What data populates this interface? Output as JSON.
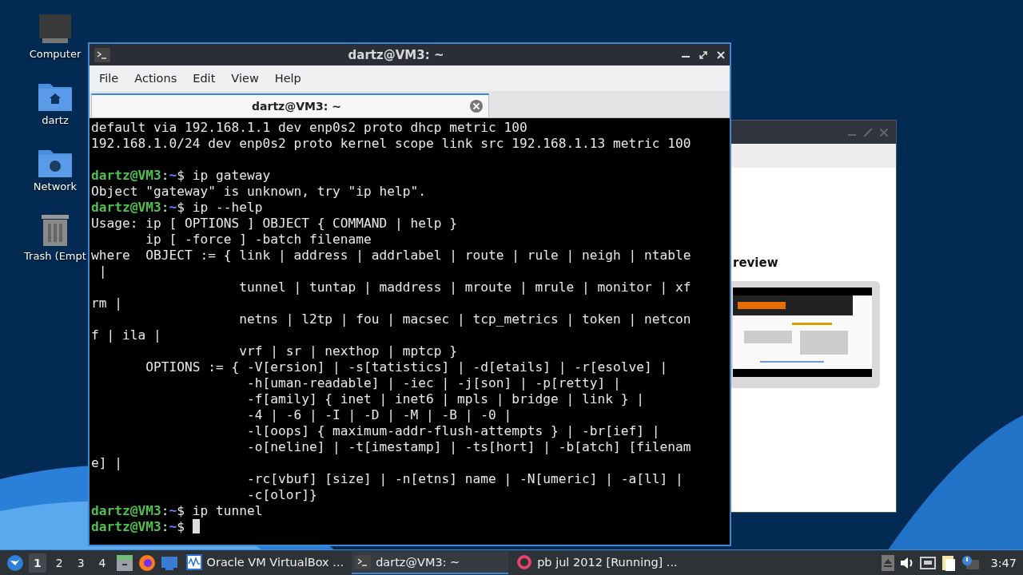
{
  "desktop_icons": [
    {
      "kind": "computer",
      "label": "Computer"
    },
    {
      "kind": "home",
      "label": "dartz"
    },
    {
      "kind": "network",
      "label": "Network"
    },
    {
      "kind": "trash",
      "label": "Trash (Empt"
    }
  ],
  "back_window": {
    "heading": "review"
  },
  "terminal": {
    "title": "dartz@VM3: ~",
    "menu": [
      "File",
      "Actions",
      "Edit",
      "View",
      "Help"
    ],
    "tabs": [
      {
        "label": "dartz@VM3: ~",
        "selected": true
      }
    ],
    "lines": [
      {
        "kind": "output",
        "text": "default via 192.168.1.1 dev enp0s2 proto dhcp metric 100"
      },
      {
        "kind": "output",
        "text": "192.168.1.0/24 dev enp0s2 proto kernel scope link src 192.168.1.13 metric 100"
      },
      {
        "kind": "blank"
      },
      {
        "kind": "prompt",
        "user": "dartz@VM3",
        "sep": ":",
        "path": "~",
        "sign": "$",
        "command": "ip gateway"
      },
      {
        "kind": "output",
        "text": "Object \"gateway\" is unknown, try \"ip help\"."
      },
      {
        "kind": "prompt",
        "user": "dartz@VM3",
        "sep": ":",
        "path": "~",
        "sign": "$",
        "command": "ip --help"
      },
      {
        "kind": "output",
        "text": "Usage: ip [ OPTIONS ] OBJECT { COMMAND | help }"
      },
      {
        "kind": "output",
        "text": "       ip [ -force ] -batch filename"
      },
      {
        "kind": "output",
        "text": "where  OBJECT := { link | address | addrlabel | route | rule | neigh | ntable"
      },
      {
        "kind": "output",
        "text": " |"
      },
      {
        "kind": "output",
        "text": "                   tunnel | tuntap | maddress | mroute | mrule | monitor | xf"
      },
      {
        "kind": "output",
        "text": "rm |"
      },
      {
        "kind": "output",
        "text": "                   netns | l2tp | fou | macsec | tcp_metrics | token | netcon"
      },
      {
        "kind": "output",
        "text": "f | ila |"
      },
      {
        "kind": "output",
        "text": "                   vrf | sr | nexthop | mptcp }"
      },
      {
        "kind": "output",
        "text": "       OPTIONS := { -V[ersion] | -s[tatistics] | -d[etails] | -r[esolve] |"
      },
      {
        "kind": "output",
        "text": "                    -h[uman-readable] | -iec | -j[son] | -p[retty] |"
      },
      {
        "kind": "output",
        "text": "                    -f[amily] { inet | inet6 | mpls | bridge | link } |"
      },
      {
        "kind": "output",
        "text": "                    -4 | -6 | -I | -D | -M | -B | -0 |"
      },
      {
        "kind": "output",
        "text": "                    -l[oops] { maximum-addr-flush-attempts } | -br[ief] |"
      },
      {
        "kind": "output",
        "text": "                    -o[neline] | -t[imestamp] | -ts[hort] | -b[atch] [filenam"
      },
      {
        "kind": "output",
        "text": "e] |"
      },
      {
        "kind": "output",
        "text": "                    -rc[vbuf] [size] | -n[etns] name | -N[umeric] | -a[ll] |"
      },
      {
        "kind": "output",
        "text": "                    -c[olor]}"
      },
      {
        "kind": "prompt",
        "user": "dartz@VM3",
        "sep": ":",
        "path": "~",
        "sign": "$",
        "command": "ip tunnel"
      },
      {
        "kind": "prompt",
        "user": "dartz@VM3",
        "sep": ":",
        "path": "~",
        "sign": "$",
        "cursor": true
      }
    ]
  },
  "taskbar": {
    "workspaces": [
      {
        "label": "1",
        "selected": true
      },
      {
        "label": "2",
        "selected": false
      },
      {
        "label": "3",
        "selected": false
      },
      {
        "label": "4",
        "selected": false
      }
    ],
    "launchers": [
      {
        "kind": "files"
      },
      {
        "kind": "firefox"
      },
      {
        "kind": "desktop"
      }
    ],
    "tasks": [
      {
        "kind": "virtualbox",
        "label": "Oracle VM VirtualBox ...",
        "selected": false
      },
      {
        "kind": "terminal",
        "label": "dartz@VM3: ~",
        "selected": true
      },
      {
        "kind": "vm",
        "label": "pb jul 2012 [Running] ...",
        "selected": false
      }
    ],
    "clock": "3:47"
  }
}
